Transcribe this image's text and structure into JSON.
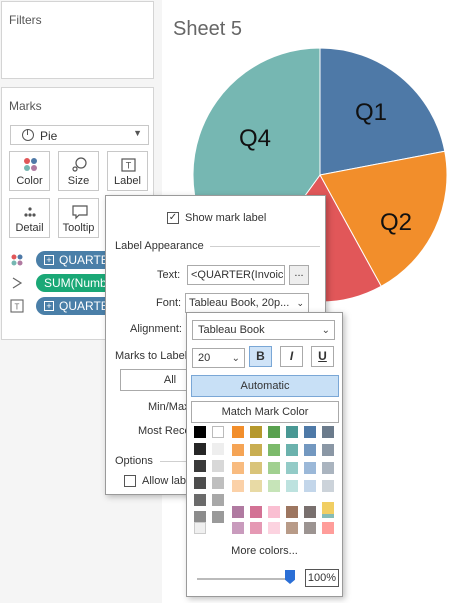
{
  "filters": {
    "title": "Filters"
  },
  "marks": {
    "title": "Marks",
    "mark_type": "Pie",
    "buttons": {
      "color": "Color",
      "size": "Size",
      "label": "Label",
      "detail": "Detail",
      "tooltip": "Tooltip"
    },
    "pills": [
      {
        "text": "QUARTER",
        "color": "#4a7fa8"
      },
      {
        "text": "SUM(Numb",
        "color": "#1aa876"
      },
      {
        "text": "QUARTER",
        "color": "#4a7fa8"
      }
    ]
  },
  "sheet": {
    "title": "Sheet 5"
  },
  "chart_data": {
    "type": "pie",
    "title": "Sheet 5",
    "categories": [
      "Q1",
      "Q2",
      "Q3",
      "Q4"
    ],
    "values": [
      22,
      20,
      18,
      40
    ],
    "colors": [
      "#4e79a7",
      "#f28e2b",
      "#e15759",
      "#76b7b2"
    ]
  },
  "label_popup": {
    "show_mark_label": "Show mark label",
    "show_mark_label_checked": true,
    "label_appearance": "Label Appearance",
    "text_label": "Text:",
    "text_value": "<QUARTER(Invoic",
    "text_button": "...",
    "font_label": "Font:",
    "font_value": "Tableau Book, 20p...",
    "alignment_label": "Alignment:",
    "marks_to_label": "Marks to Label",
    "all_option": "All",
    "min_max_option": "Min/Max",
    "most_recent_option": "Most Rece",
    "options": "Options",
    "allow_label": "Allow lab"
  },
  "font_panel": {
    "font_family": "Tableau Book",
    "font_size": "20",
    "bold": "B",
    "italic": "I",
    "underline": "U",
    "automatic": "Automatic",
    "match_mark_color": "Match Mark Color",
    "more_colors": "More colors...",
    "opacity": "100%"
  }
}
